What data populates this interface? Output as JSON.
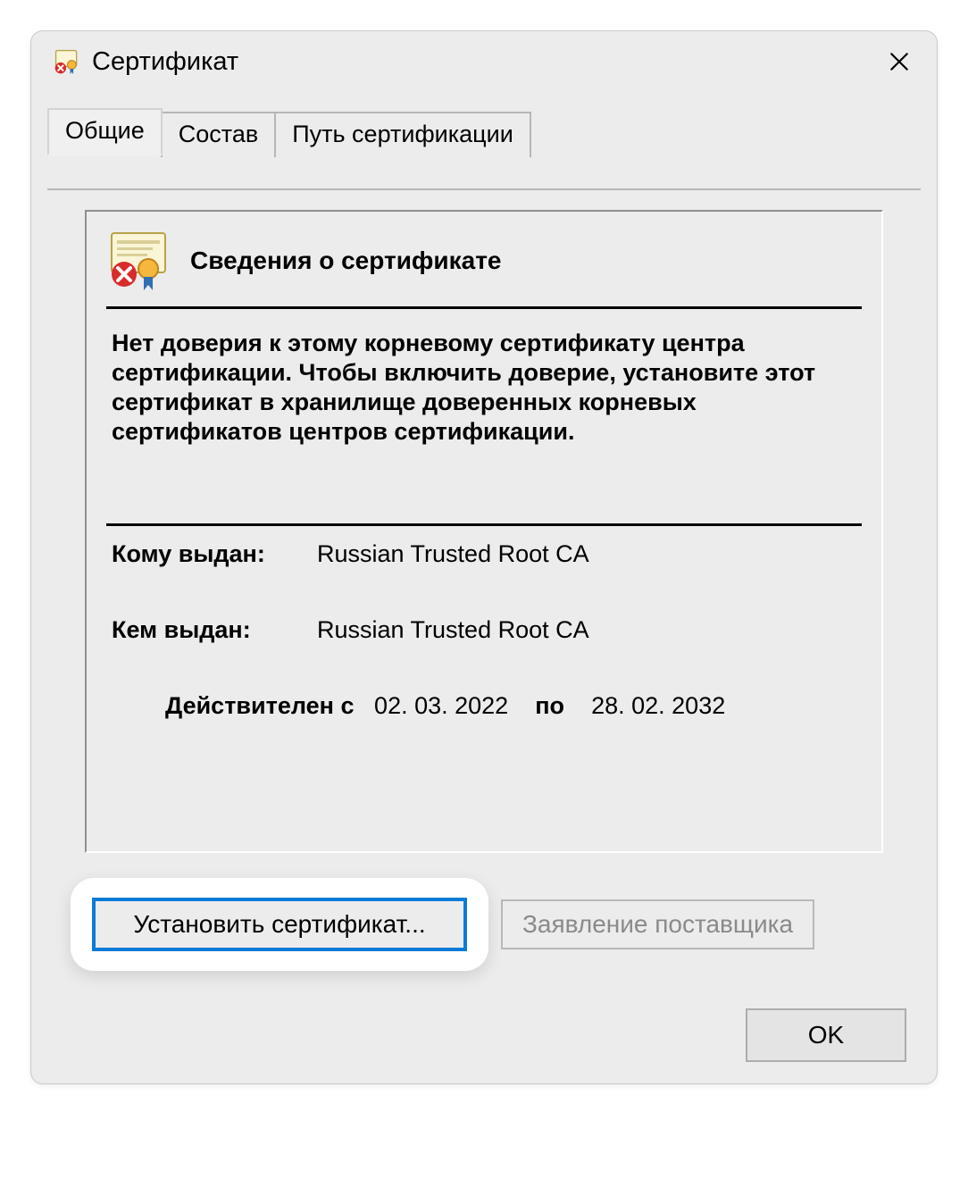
{
  "window": {
    "title": "Сертификат",
    "icon": "certificate-error-icon"
  },
  "tabs": [
    {
      "label": "Общие",
      "active": true
    },
    {
      "label": "Состав",
      "active": false
    },
    {
      "label": "Путь сертификации",
      "active": false
    }
  ],
  "info": {
    "heading": "Сведения о сертификате",
    "warning": "Нет доверия к этому корневому сертификату центра сертификации. Чтобы включить  доверие, установите этот сертификат в хранилище доверенных корневых сертификатов центров сертификации.",
    "issued_to_label": "Кому выдан:",
    "issued_to_value": "Russian Trusted Root CA",
    "issued_by_label": "Кем выдан:",
    "issued_by_value": "Russian Trusted Root CA",
    "valid_prefix": "Действителен с",
    "valid_from": "02. 03. 2022",
    "valid_mid": "по",
    "valid_to": "28. 02. 2032"
  },
  "buttons": {
    "install": "Установить сертификат...",
    "issuer_statement": "Заявление поставщика",
    "ok": "OK"
  },
  "colors": {
    "highlight_border": "#0a7bd6",
    "window_bg": "#ececec"
  }
}
